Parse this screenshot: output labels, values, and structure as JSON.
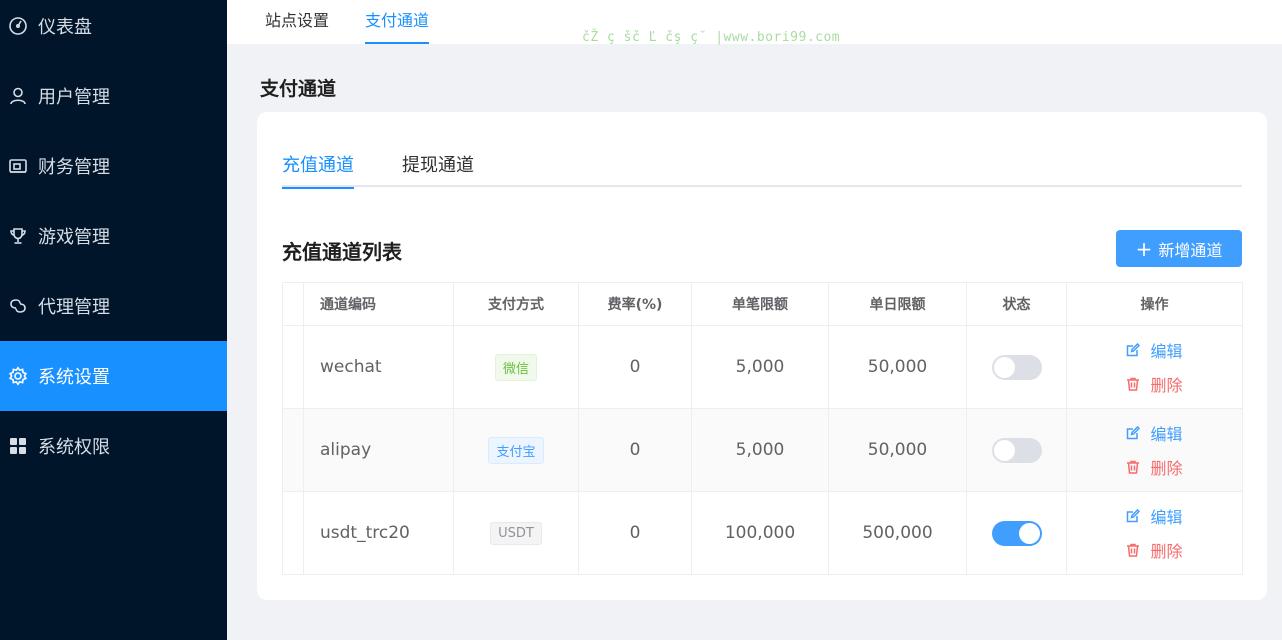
{
  "sidebar": {
    "items": [
      {
        "label": "仪表盘",
        "icon": "dashboard-icon"
      },
      {
        "label": "用户管理",
        "icon": "user-icon"
      },
      {
        "label": "财务管理",
        "icon": "wallet-icon"
      },
      {
        "label": "游戏管理",
        "icon": "trophy-icon"
      },
      {
        "label": "代理管理",
        "icon": "link-icon"
      },
      {
        "label": "系统设置",
        "icon": "gear-icon",
        "active": true
      },
      {
        "label": "系统权限",
        "icon": "grid-icon"
      }
    ]
  },
  "top_tabs": {
    "items": [
      {
        "label": "站点设置"
      },
      {
        "label": "支付通道",
        "active": true
      }
    ]
  },
  "watermark": "čŽ ç šč Ľ čş ç˘ |www.bori99.com",
  "page_title": "支付通道",
  "card": {
    "tabs": [
      {
        "label": "充值通道",
        "active": true
      },
      {
        "label": "提现通道"
      }
    ],
    "list_title": "充值通道列表",
    "add_button": {
      "icon": "+",
      "label": "新增通道"
    }
  },
  "table": {
    "columns": [
      "通道编码",
      "支付方式",
      "费率(%)",
      "单笔限额",
      "单日限额",
      "状态",
      "操作"
    ],
    "rows": [
      {
        "code": "wechat",
        "method": "微信",
        "rate": "0",
        "single_limit": "5,000",
        "daily_limit": "50,000",
        "enabled": false,
        "edit": "编辑",
        "delete": "删除"
      },
      {
        "code": "alipay",
        "method": "支付宝",
        "rate": "0",
        "single_limit": "5,000",
        "daily_limit": "50,000",
        "enabled": false,
        "edit": "编辑",
        "delete": "删除"
      },
      {
        "code": "usdt_trc20",
        "method": "USDT",
        "rate": "0",
        "single_limit": "100,000",
        "daily_limit": "500,000",
        "enabled": true,
        "edit": "编辑",
        "delete": "删除"
      }
    ]
  },
  "colors": {
    "sidebar_bg": "#001529",
    "active_blue": "#1890ff",
    "button_blue": "#409eff",
    "danger": "#f56c6c"
  }
}
